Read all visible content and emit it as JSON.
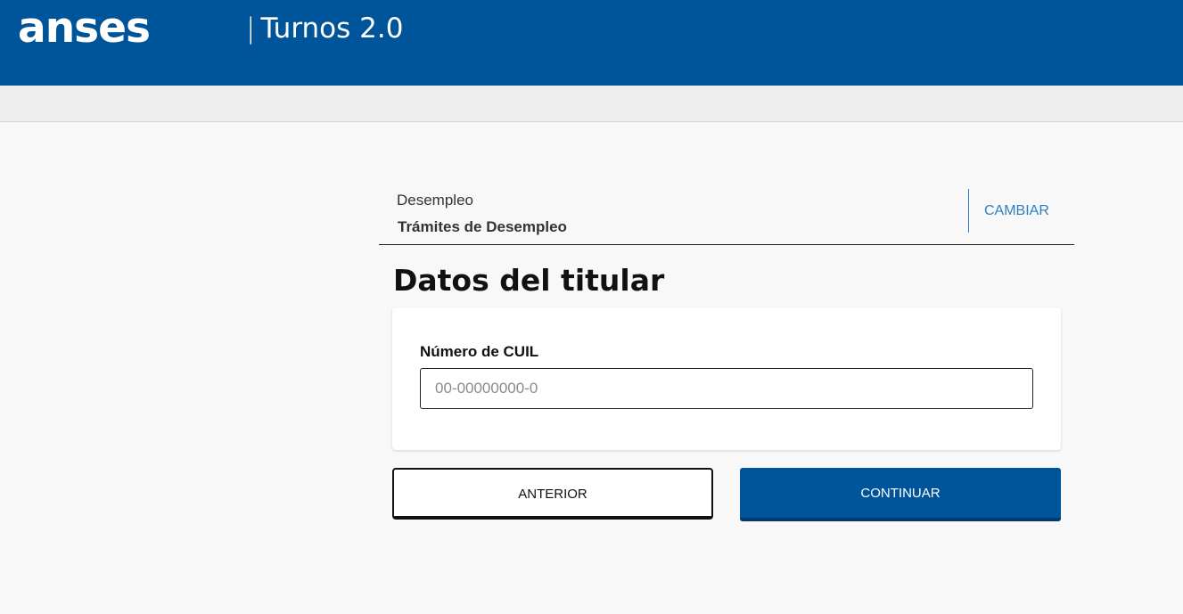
{
  "header": {
    "logo_text": "anses",
    "separator": "|",
    "app_title": "Turnos 2.0",
    "background_color": "#00549a"
  },
  "service": {
    "category": "Desempleo",
    "name": "Trámites de Desempleo",
    "change_label": "CAMBIAR"
  },
  "form": {
    "title": "Datos del titular",
    "cuil_label": "Número de CUIL",
    "cuil_placeholder": "00-00000000-0",
    "cuil_value": ""
  },
  "actions": {
    "back_label": "ANTERIOR",
    "next_label": "CONTINUAR",
    "accent_color": "#00549a"
  }
}
